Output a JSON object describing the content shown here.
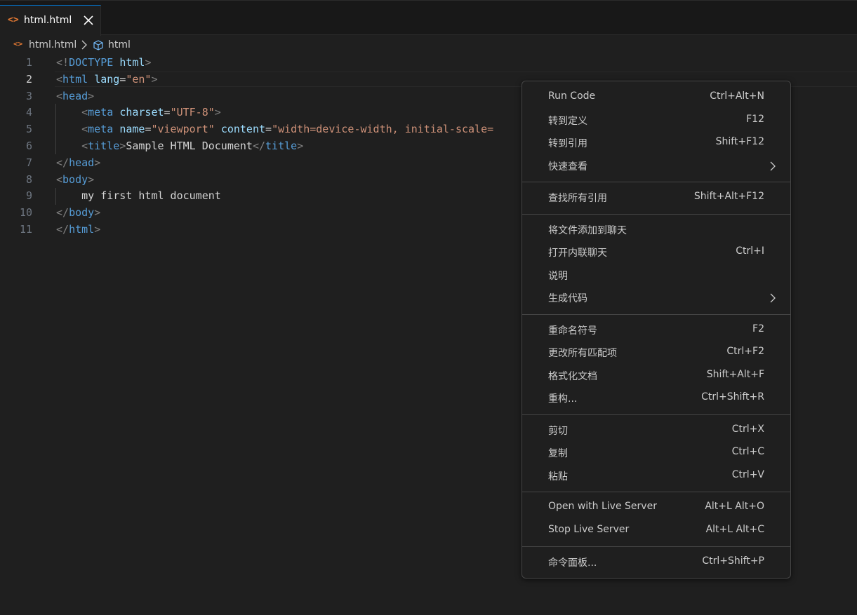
{
  "tab": {
    "label": "html.html",
    "file_icon": "<>",
    "close_icon": "close-icon"
  },
  "breadcrumb": {
    "file_icon": "<>",
    "file": "html.html",
    "symbol_icon": "symbol-structure-icon",
    "symbol": "html"
  },
  "editor": {
    "active_line": 2,
    "line_numbers": [
      "1",
      "2",
      "3",
      "4",
      "5",
      "6",
      "7",
      "8",
      "9",
      "10",
      "11"
    ],
    "lines": [
      [
        [
          "p",
          "<!"
        ],
        [
          "t",
          "DOCTYPE"
        ],
        [
          "x",
          " "
        ],
        [
          "a",
          "html"
        ],
        [
          "p",
          ">"
        ]
      ],
      [
        [
          "p",
          "<"
        ],
        [
          "t",
          "html"
        ],
        [
          "x",
          " "
        ],
        [
          "a",
          "lang"
        ],
        [
          "x",
          "="
        ],
        [
          "s",
          "\"en\""
        ],
        [
          "p",
          ">"
        ]
      ],
      [
        [
          "p",
          "<"
        ],
        [
          "t",
          "head"
        ],
        [
          "p",
          ">"
        ]
      ],
      [
        [
          "x",
          "    "
        ],
        [
          "p",
          "<"
        ],
        [
          "t",
          "meta"
        ],
        [
          "x",
          " "
        ],
        [
          "a",
          "charset"
        ],
        [
          "x",
          "="
        ],
        [
          "s",
          "\"UTF-8\""
        ],
        [
          "p",
          ">"
        ]
      ],
      [
        [
          "x",
          "    "
        ],
        [
          "p",
          "<"
        ],
        [
          "t",
          "meta"
        ],
        [
          "x",
          " "
        ],
        [
          "a",
          "name"
        ],
        [
          "x",
          "="
        ],
        [
          "s",
          "\"viewport\""
        ],
        [
          "x",
          " "
        ],
        [
          "a",
          "content"
        ],
        [
          "x",
          "="
        ],
        [
          "s",
          "\"width=device-width, initial-scale="
        ]
      ],
      [
        [
          "x",
          "    "
        ],
        [
          "p",
          "<"
        ],
        [
          "t",
          "title"
        ],
        [
          "p",
          ">"
        ],
        [
          "x",
          "Sample HTML Document"
        ],
        [
          "p",
          "</"
        ],
        [
          "t",
          "title"
        ],
        [
          "p",
          ">"
        ]
      ],
      [
        [
          "p",
          "</"
        ],
        [
          "t",
          "head"
        ],
        [
          "p",
          ">"
        ]
      ],
      [
        [
          "p",
          "<"
        ],
        [
          "t",
          "body"
        ],
        [
          "p",
          ">"
        ]
      ],
      [
        [
          "x",
          "    my first html document"
        ]
      ],
      [
        [
          "p",
          "</"
        ],
        [
          "t",
          "body"
        ],
        [
          "p",
          ">"
        ]
      ],
      [
        [
          "p",
          "</"
        ],
        [
          "t",
          "html"
        ],
        [
          "p",
          ">"
        ]
      ]
    ]
  },
  "context_menu": {
    "submenu_icon": "chevron-right-icon",
    "groups": [
      [
        {
          "id": "run-code",
          "label": "Run Code",
          "shortcut": "Ctrl+Alt+N"
        },
        {
          "id": "go-to-definition",
          "label": "转到定义",
          "shortcut": "F12"
        },
        {
          "id": "go-to-references",
          "label": "转到引用",
          "shortcut": "Shift+F12"
        },
        {
          "id": "peek",
          "label": "快速查看",
          "shortcut": "",
          "submenu": true
        }
      ],
      [
        {
          "id": "find-all-references",
          "label": "查找所有引用",
          "shortcut": "Shift+Alt+F12"
        }
      ],
      [
        {
          "id": "add-file-to-chat",
          "label": "将文件添加到聊天",
          "shortcut": ""
        },
        {
          "id": "open-inline-chat",
          "label": "打开内联聊天",
          "shortcut": "Ctrl+I"
        },
        {
          "id": "explain",
          "label": "说明",
          "shortcut": ""
        },
        {
          "id": "generate-code",
          "label": "生成代码",
          "shortcut": "",
          "submenu": true
        }
      ],
      [
        {
          "id": "rename-symbol",
          "label": "重命名符号",
          "shortcut": "F2"
        },
        {
          "id": "change-all-occurrences",
          "label": "更改所有匹配项",
          "shortcut": "Ctrl+F2"
        },
        {
          "id": "format-document",
          "label": "格式化文档",
          "shortcut": "Shift+Alt+F"
        },
        {
          "id": "refactor",
          "label": "重构...",
          "shortcut": "Ctrl+Shift+R"
        }
      ],
      [
        {
          "id": "cut",
          "label": "剪切",
          "shortcut": "Ctrl+X"
        },
        {
          "id": "copy",
          "label": "复制",
          "shortcut": "Ctrl+C"
        },
        {
          "id": "paste",
          "label": "粘贴",
          "shortcut": "Ctrl+V"
        }
      ],
      [
        {
          "id": "open-with-live-server",
          "label": "Open with Live Server",
          "shortcut": "Alt+L Alt+O"
        },
        {
          "id": "stop-live-server",
          "label": "Stop Live Server",
          "shortcut": "Alt+L Alt+C"
        }
      ],
      [
        {
          "id": "command-palette",
          "label": "命令面板...",
          "shortcut": "Ctrl+Shift+P"
        }
      ]
    ]
  },
  "colors": {
    "background": "#1f1f1f",
    "tab_active_border": "#0078d4",
    "html_file_icon": "#e37933",
    "tag": "#569cd6",
    "attribute": "#9cdcfe",
    "string": "#ce9178",
    "punctuation": "#808080",
    "menu_border": "#454545"
  }
}
